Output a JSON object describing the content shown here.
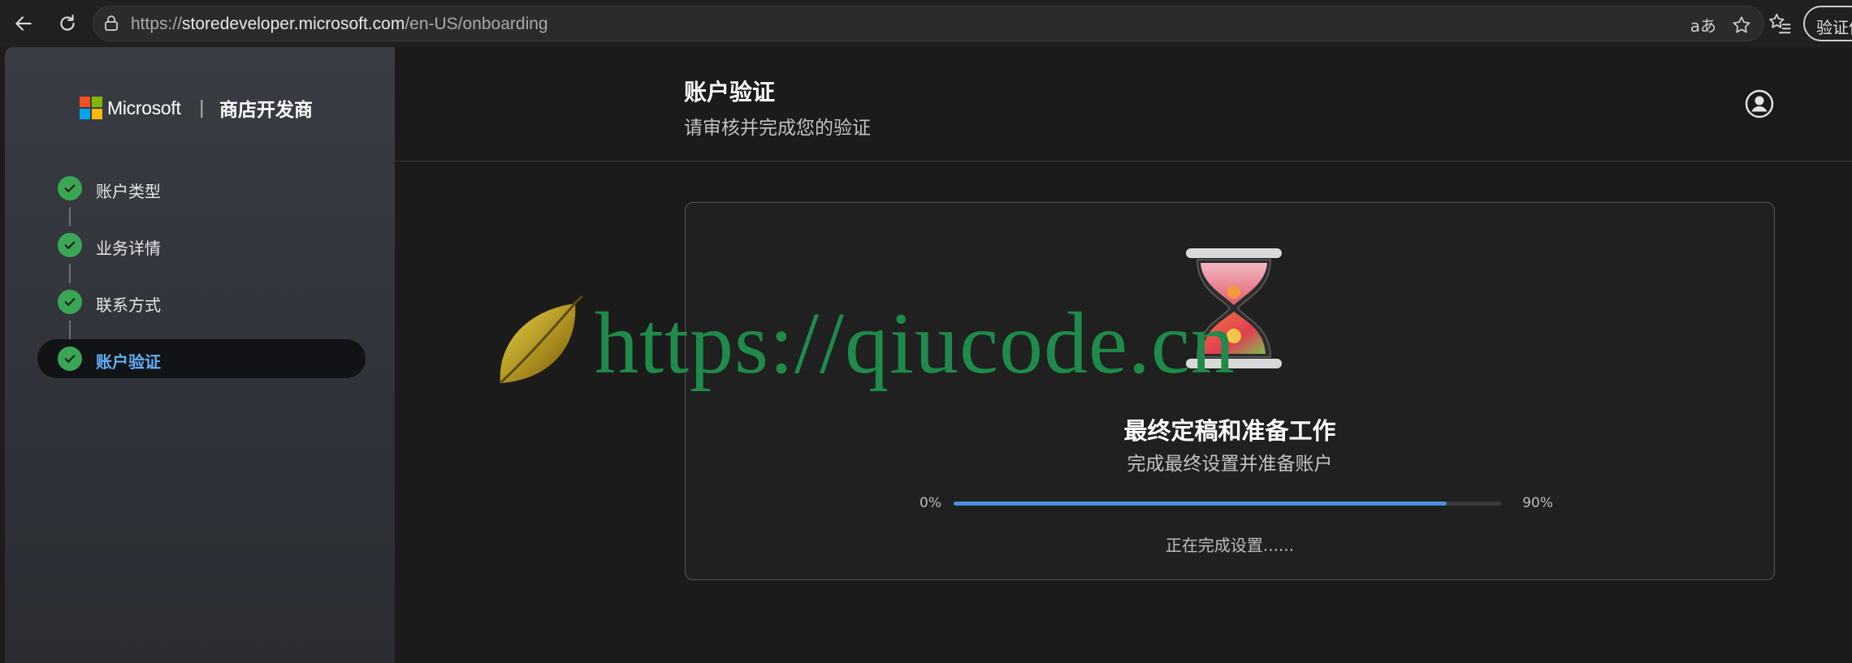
{
  "browser": {
    "url_prefix": "https://",
    "url_host": "storedeveloper.microsoft.com",
    "url_path": "/en-US/onboarding",
    "read_aloud_glyph": "aあ",
    "profile_button_label": "验证信"
  },
  "sidebar": {
    "brand_name": "Microsoft",
    "separator": "|",
    "product_name": "商店开发商",
    "steps": [
      {
        "label": "账户类型",
        "status": "completed"
      },
      {
        "label": "业务详情",
        "status": "completed"
      },
      {
        "label": "联系方式",
        "status": "completed"
      },
      {
        "label": "账户验证",
        "status": "completed-active"
      }
    ]
  },
  "header": {
    "title": "账户验证",
    "subtitle": "请审核并完成您的验证"
  },
  "card": {
    "title": "最终定稿和准备工作",
    "subtitle": "完成最终设置并准备账户",
    "progress_start_label": "0%",
    "progress_end_label": "90%",
    "progress_value": 0.9,
    "status_text": "正在完成设置......"
  },
  "watermark": {
    "text": "https://qiucode.cn"
  },
  "colors": {
    "accent_blue": "#64aff8",
    "progress_blue": "#4a8fe0",
    "check_green": "#3aa655",
    "ms_red": "#f25022",
    "ms_green": "#7fba00",
    "ms_blue": "#00a4ef",
    "ms_yellow": "#ffb900"
  },
  "icons": {
    "back": "arrow-left-icon",
    "refresh": "refresh-icon",
    "lock": "lock-icon",
    "favorite": "star-icon",
    "favorites_list": "favorites-list-icon",
    "account": "user-circle-icon",
    "step_check": "check-icon",
    "card_illustration": "hourglass-icon",
    "watermark_logo": "leaf-icon"
  }
}
